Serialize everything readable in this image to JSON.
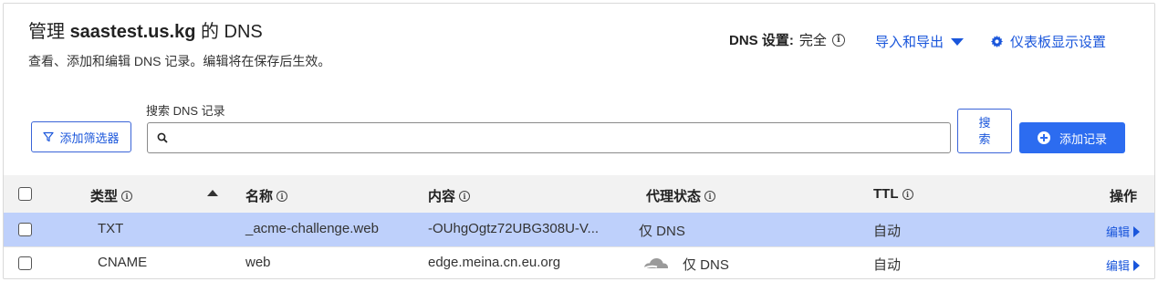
{
  "header": {
    "title_prefix": "管理",
    "domain": "saastest.us.kg",
    "title_suffix": "的 DNS",
    "subtitle": "查看、添加和编辑 DNS 记录。编辑将在保存后生效。"
  },
  "dns_setting": {
    "label": "DNS 设置:",
    "value": "完全"
  },
  "actions": {
    "import_export": "导入和导出",
    "dashboard_settings": "仪表板显示设置"
  },
  "search": {
    "label": "搜索 DNS 记录",
    "placeholder": "",
    "value": "",
    "button_line1": "搜",
    "button_line2": "索"
  },
  "filter_button": "添加筛选器",
  "add_record_button": "添加记录",
  "table": {
    "columns": {
      "type": "类型",
      "name": "名称",
      "content": "内容",
      "proxy_status": "代理状态",
      "ttl": "TTL",
      "actions": "操作"
    },
    "rows": [
      {
        "type": "TXT",
        "name": "_acme-challenge.web",
        "content": "-OUhgOgtz72UBG308U-V...",
        "proxy": "仅 DNS",
        "ttl": "自动",
        "edit": "编辑"
      },
      {
        "type": "CNAME",
        "name": "web",
        "content": "edge.meina.cn.eu.org",
        "proxy": "仅 DNS",
        "ttl": "自动",
        "edit": "编辑"
      }
    ]
  },
  "colors": {
    "accent": "#2c6cf0",
    "link": "#1a56db",
    "selected_row": "#bed0fb",
    "header_bg": "#f2f2f2"
  }
}
